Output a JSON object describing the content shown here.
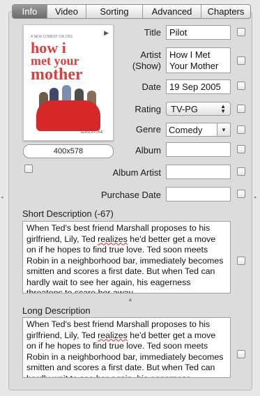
{
  "tabs": [
    {
      "label": "Info",
      "active": true
    },
    {
      "label": "Video",
      "active": false
    },
    {
      "label": "Sorting",
      "active": false
    },
    {
      "label": "Advanced",
      "active": false
    },
    {
      "label": "Chapters",
      "active": false
    }
  ],
  "artwork": {
    "tagline": "A NEW COMEDY ON CBS",
    "title_lines": [
      "how i",
      "met your",
      "mother"
    ],
    "season": "SEASON ONE",
    "size": "400x578"
  },
  "fields": {
    "title": {
      "label": "Title",
      "value": "Pilot"
    },
    "artist": {
      "label_line1": "Artist",
      "label_line2": "(Show)",
      "value": "How I Met Your Mother"
    },
    "date": {
      "label": "Date",
      "value": "19 Sep 2005"
    },
    "rating": {
      "label": "Rating",
      "value": "TV-PG"
    },
    "genre": {
      "label": "Genre",
      "value": "Comedy"
    },
    "album": {
      "label": "Album",
      "value": ""
    },
    "album_artist": {
      "label": "Album Artist",
      "value": ""
    },
    "purchase_date": {
      "label": "Purchase Date",
      "value": ""
    }
  },
  "short_description": {
    "label": "Short Description (-67)",
    "before": "When Ted's best friend Marshall proposes to his girlfriend, Lily, Ted ",
    "flagged_word": "realizes",
    "after": " he'd better get a move on if he hopes to find true love. Ted soon meets Robin in a neighborhood bar, immediately becomes smitten and scores a first date. But when Ted can hardly wait to see her again, his eagerness threatens to scare her away."
  },
  "long_description": {
    "label": "Long Description",
    "before": "When Ted's best friend Marshall proposes to his girlfriend, Lily, Ted ",
    "flagged_word": "realizes",
    "after": " he'd better get a move on if he hopes to find true love. Ted soon meets Robin in a neighborhood bar, immediately becomes smitten and scores a first date. But when Ted can hardly wait to see her again, his eagerness"
  },
  "icons": {
    "play": "play-icon",
    "select_arrows": "up-down-chevron-icon",
    "combo_arrow": "triangle-down-icon",
    "split_handle": "caret-up-icon"
  },
  "colors": {
    "panel_bg": "#dcdcdc",
    "active_tab": "#6b6b6b",
    "poster_red": "#d62828",
    "spell_underline": "#dd2222"
  }
}
